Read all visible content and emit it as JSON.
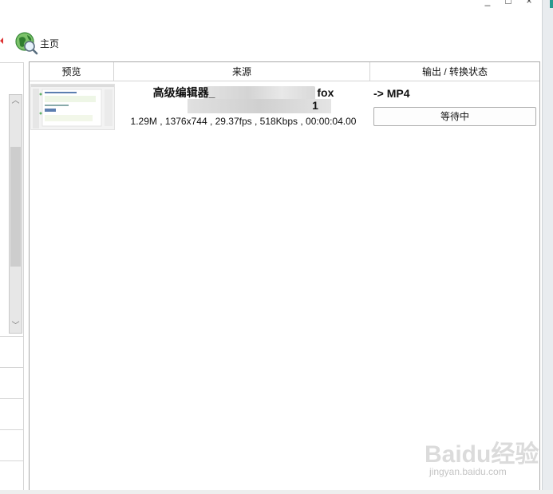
{
  "toolbar": {
    "home_label": "主页"
  },
  "table": {
    "columns": [
      "预览",
      "来源",
      "输出 / 转换状态"
    ],
    "rows": [
      {
        "source_title": "高级编辑器_",
        "source_title_tail": "fox",
        "source_line2_tail": "1",
        "source_info": "1.29M , 1376x744 , 29.37fps , 518Kbps , 00:00:04.00",
        "output_format": "-> MP4",
        "status": "等待中"
      }
    ]
  },
  "watermark": {
    "brand": "Baidu经验",
    "url": "jingyan.baidu.com"
  },
  "colors": {
    "accent_teal": "#2a9a8f",
    "border": "#a9a9a9"
  }
}
